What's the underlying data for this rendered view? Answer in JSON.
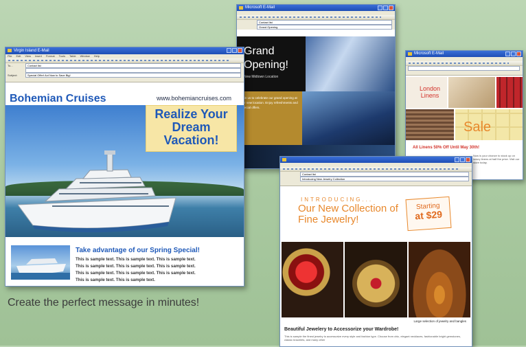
{
  "tagline": "Create the perfect message in minutes!",
  "colors": {
    "accent_blue": "#1f59b8",
    "accent_orange": "#e8882c",
    "linens_red": "#d2322a",
    "background": "#a9c9a0"
  },
  "cruise_window": {
    "title": "Virgin Island E-Mail",
    "menu": [
      "File",
      "Edit",
      "View",
      "Insert",
      "Format",
      "Tools",
      "Table",
      "Window",
      "Help"
    ],
    "to_label": "To...",
    "to_value": "Contact list",
    "subject_label": "Subject:",
    "subject_value": "Special Offer! Act Now to Save Big!",
    "brand": "Bohemian Cruises",
    "url": "www.bohemiancruises.com",
    "headline_lines": [
      "Realize Your",
      "Dream",
      "Vacation!"
    ],
    "promo_title": "Take advantage of our Spring Special!",
    "promo_lines": [
      "This is sample text. This is sample text. This is sample text.",
      "This is sample text. This is sample text. This is sample text.",
      "This is sample text. This is sample text. This is sample text.",
      "This is sample text. This is sample text."
    ]
  },
  "grand_opening_window": {
    "title": "Microsoft E-Mail",
    "to_value": "Contact list",
    "subject_value": "Grand Opening",
    "title_lines": [
      "Grand",
      "Opening!"
    ],
    "subtitle": "New Midtown Location",
    "band_text": "Join us to celebrate our grand opening at our new location. Enjoy refreshments and special offers."
  },
  "linens_window": {
    "title": "Microsoft E-Mail",
    "london": "London Linens",
    "sale": "Sale",
    "offer": "All Linens 50% Off Until May 30th!",
    "small_text": "Now is your chance to stock up on luxury linens at half the price. Visit our store today."
  },
  "jewelry_window": {
    "to_value": "Contact list",
    "subject_value": "Introducing New Jewelry Collection",
    "intro": "INTRODUCING...",
    "title": "Our New Collection of Fine Jewelry!",
    "badge_line1": "Starting",
    "badge_line2": "at $29",
    "caption": "Large selection of jewelry and bangles",
    "head": "Beautiful Jewelery to Accessorize your Wardrobe!",
    "text": "This is sample the finest jewelry to accessorize every style and fashion type. Choose from chic, elegant necklaces, fashionable bright gemstones, classic bracelets, and many other"
  }
}
